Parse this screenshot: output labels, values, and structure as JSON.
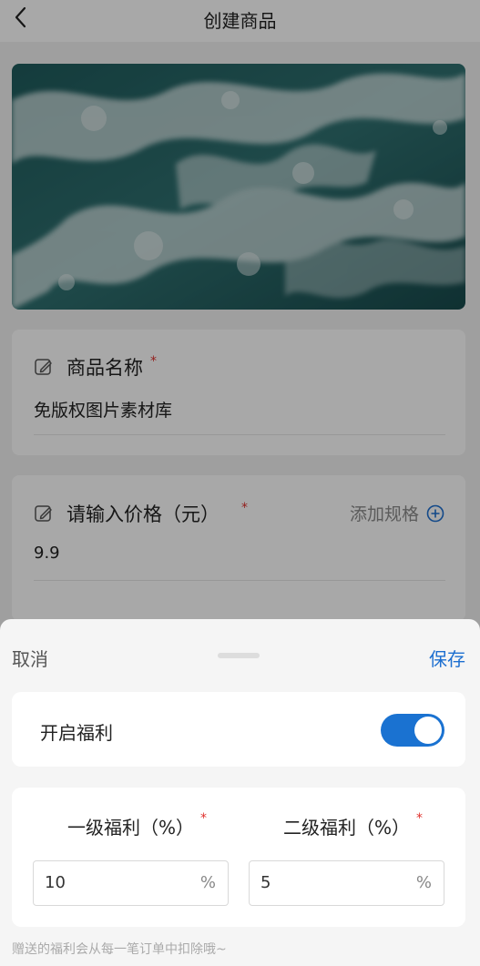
{
  "header": {
    "title": "创建商品",
    "back_icon": "chevron-left-icon"
  },
  "product_image": {
    "description_icon": "ocean-waves-image"
  },
  "name_field": {
    "label": "商品名称",
    "required_mark": "*",
    "value": "免版权图片素材库",
    "icon": "edit-icon"
  },
  "price_field": {
    "label": "请输入价格（元）",
    "required_mark": "*",
    "value": "9.9",
    "icon": "edit-icon",
    "add_spec_label": "添加规格",
    "add_spec_icon": "plus-circle-icon"
  },
  "sheet": {
    "cancel_label": "取消",
    "save_label": "保存",
    "accent_color": "#1d6fd0",
    "toggle_label": "开启福利",
    "toggle_on": true,
    "benefits": [
      {
        "title": "一级福利（%）",
        "required_mark": "*",
        "value": "10",
        "suffix": "%"
      },
      {
        "title": "二级福利（%）",
        "required_mark": "*",
        "value": "5",
        "suffix": "%"
      }
    ],
    "hint": "赠送的福利会从每一笔订单中扣除哦~"
  }
}
